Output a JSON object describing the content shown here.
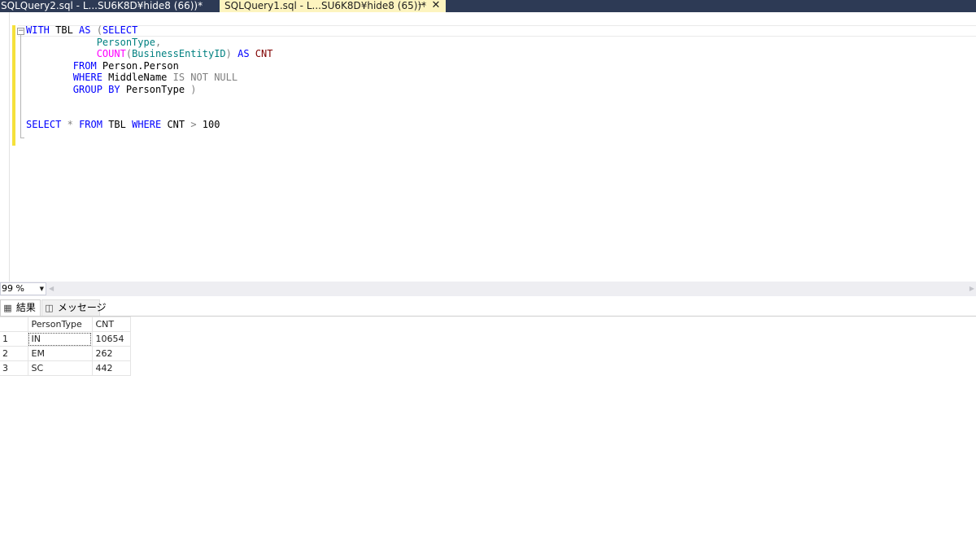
{
  "tabs": [
    {
      "label": "SQLQuery2.sql - L...SU6K8D¥hide8 (66))*",
      "active": false
    },
    {
      "label": "SQLQuery1.sql - L...SU6K8D¥hide8 (65))*",
      "active": true
    }
  ],
  "tab_pin_glyph": "⊣",
  "tab_close_glyph": "✕",
  "editor": {
    "fold_glyph": "−",
    "code_lines": [
      [
        {
          "t": "WITH",
          "c": "kw"
        },
        {
          "t": " TBL ",
          "c": "obj"
        },
        {
          "t": "AS",
          "c": "kw"
        },
        {
          "t": " ",
          "c": "obj"
        },
        {
          "t": "(",
          "c": "gr"
        },
        {
          "t": "SELECT",
          "c": "kw"
        }
      ],
      [
        {
          "t": "            PersonType",
          "c": "col"
        },
        {
          "t": ",",
          "c": "gr"
        }
      ],
      [
        {
          "t": "            ",
          "c": "obj"
        },
        {
          "t": "COUNT",
          "c": "fn"
        },
        {
          "t": "(",
          "c": "gr"
        },
        {
          "t": "BusinessEntityID",
          "c": "col"
        },
        {
          "t": ")",
          "c": "gr"
        },
        {
          "t": " ",
          "c": "obj"
        },
        {
          "t": "AS",
          "c": "kw"
        },
        {
          "t": " CNT",
          "c": "cnt"
        }
      ],
      [
        {
          "t": "        ",
          "c": "obj"
        },
        {
          "t": "FROM",
          "c": "kw"
        },
        {
          "t": " Person.Person",
          "c": "obj"
        }
      ],
      [
        {
          "t": "        ",
          "c": "obj"
        },
        {
          "t": "WHERE",
          "c": "kw"
        },
        {
          "t": " MiddleName ",
          "c": "obj"
        },
        {
          "t": "IS NOT NULL",
          "c": "gr"
        }
      ],
      [
        {
          "t": "        ",
          "c": "obj"
        },
        {
          "t": "GROUP BY",
          "c": "kw"
        },
        {
          "t": " PersonType ",
          "c": "obj"
        },
        {
          "t": ")",
          "c": "gr"
        }
      ],
      [],
      [],
      [
        {
          "t": "SELECT",
          "c": "kw"
        },
        {
          "t": " ",
          "c": "obj"
        },
        {
          "t": "*",
          "c": "gr"
        },
        {
          "t": " ",
          "c": "obj"
        },
        {
          "t": "FROM",
          "c": "kw"
        },
        {
          "t": " TBL ",
          "c": "obj"
        },
        {
          "t": "WHERE",
          "c": "kw"
        },
        {
          "t": " CNT ",
          "c": "obj"
        },
        {
          "t": ">",
          "c": "gr"
        },
        {
          "t": " 100",
          "c": "obj"
        }
      ]
    ]
  },
  "zoom": {
    "value": "99 %",
    "arrow": "▼"
  },
  "scroll": {
    "left": "◀",
    "right": "▶"
  },
  "result_tabs": [
    {
      "icon": "▦",
      "label": "結果",
      "active": true
    },
    {
      "icon": "◫",
      "label": "メッセージ",
      "active": false
    }
  ],
  "grid": {
    "columns": [
      "PersonType",
      "CNT"
    ],
    "rows": [
      {
        "num": "1",
        "cells": [
          "IN",
          "10654"
        ]
      },
      {
        "num": "2",
        "cells": [
          "EM",
          "262"
        ]
      },
      {
        "num": "3",
        "cells": [
          "SC",
          "442"
        ]
      }
    ]
  },
  "colors": {
    "keyword": "#0000ff",
    "function": "#ff00ff",
    "operator": "#808080",
    "tabbar": "#2d3a55",
    "active_tab": "#fdf4bf",
    "change_bar": "#f5e13b"
  }
}
